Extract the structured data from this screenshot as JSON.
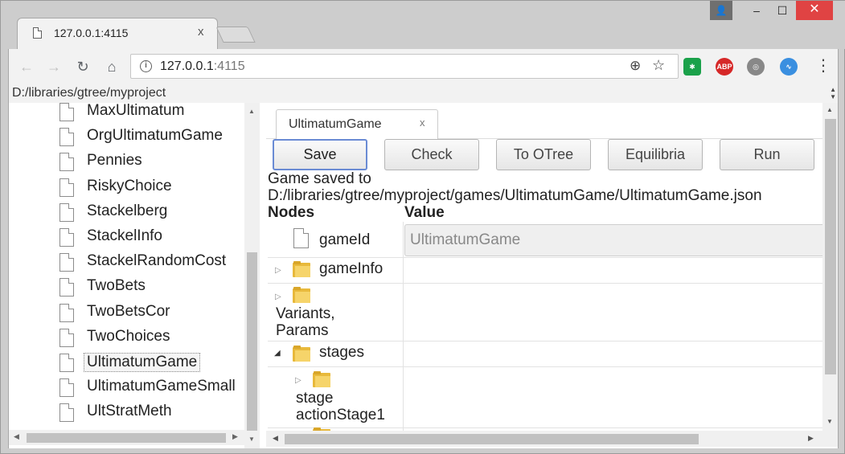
{
  "browser": {
    "tab_title": "127.0.0.1:4115",
    "tab_close": "x",
    "url_host": "127.0.0.1",
    "url_port": ":4115",
    "window_close": "✕",
    "window_min": "–",
    "window_max": "☐",
    "user_icon": "👤",
    "ext_abp": "ABP"
  },
  "project_path": "D:/libraries/gtree/myproject",
  "tree_items": [
    {
      "label": "MaxUltimatum"
    },
    {
      "label": "OrgUltimatumGame"
    },
    {
      "label": "Pennies"
    },
    {
      "label": "RiskyChoice"
    },
    {
      "label": "Stackelberg"
    },
    {
      "label": "StackelInfo"
    },
    {
      "label": "StackelRandomCost"
    },
    {
      "label": "TwoBets"
    },
    {
      "label": "TwoBetsCor"
    },
    {
      "label": "TwoChoices"
    },
    {
      "label": "UltimatumGame",
      "selected": true
    },
    {
      "label": "UltimatumGameSmall"
    },
    {
      "label": "UltStratMeth"
    }
  ],
  "editor": {
    "tab_title": "UltimatumGame",
    "tab_close": "x",
    "buttons": {
      "save": "Save",
      "check": "Check",
      "otree": "To OTree",
      "equilibria": "Equilibria",
      "run": "Run"
    },
    "status_line1": "Game saved to",
    "status_line2": "D:/libraries/gtree/myproject/games/UltimatumGame/UltimatumGame.json",
    "header_nodes": "Nodes",
    "header_value": "Value",
    "nodes": {
      "game_id": "gameId",
      "game_id_value": "UltimatumGame",
      "game_info": "gameInfo",
      "variants_line1": "Variants,",
      "variants_line2": "Params",
      "stages": "stages",
      "stage_line1": "stage",
      "stage_line2": "actionStage1"
    }
  }
}
